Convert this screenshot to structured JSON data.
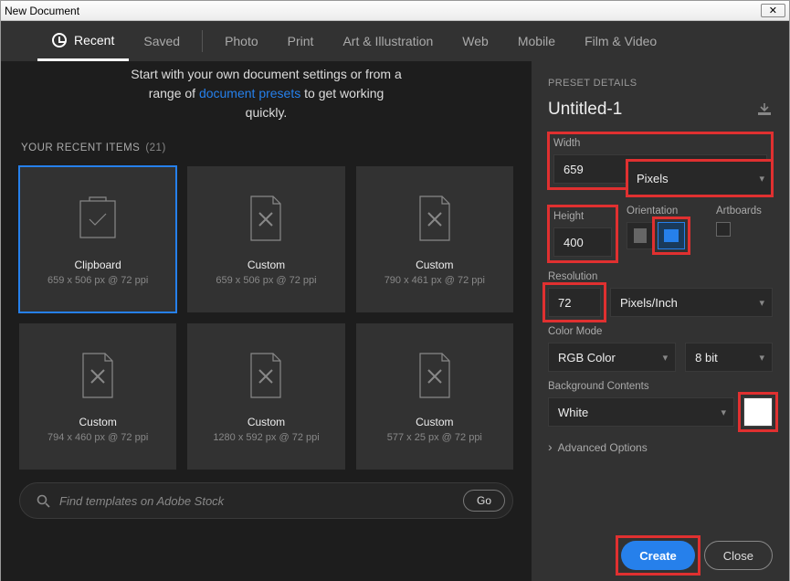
{
  "window": {
    "title": "New Document",
    "close": "✕"
  },
  "tabs": {
    "recent": "Recent",
    "saved": "Saved",
    "photo": "Photo",
    "print": "Print",
    "art": "Art & Illustration",
    "web": "Web",
    "mobile": "Mobile",
    "film": "Film & Video"
  },
  "intro": {
    "line1a": "Start with your own document settings or from a",
    "line2a": "range of ",
    "link": "document presets",
    "line2b": " to get working",
    "line3": "quickly."
  },
  "recent_label": "YOUR RECENT ITEMS",
  "recent_count": "(21)",
  "cards": [
    {
      "title": "Clipboard",
      "sub": "659 x 506 px @ 72 ppi"
    },
    {
      "title": "Custom",
      "sub": "659 x 506 px @ 72 ppi"
    },
    {
      "title": "Custom",
      "sub": "790 x 461 px @ 72 ppi"
    },
    {
      "title": "Custom",
      "sub": "794 x 460 px @ 72 ppi"
    },
    {
      "title": "Custom",
      "sub": "1280 x 592 px @ 72 ppi"
    },
    {
      "title": "Custom",
      "sub": "577 x 25 px @ 72 ppi"
    }
  ],
  "search": {
    "placeholder": "Find templates on Adobe Stock",
    "go": "Go"
  },
  "preset": {
    "header": "PRESET DETAILS",
    "docname": "Untitled-1",
    "width_label": "Width",
    "width_value": "659",
    "units": "Pixels",
    "height_label": "Height",
    "height_value": "400",
    "orientation_label": "Orientation",
    "artboards_label": "Artboards",
    "resolution_label": "Resolution",
    "resolution_value": "72",
    "resolution_units": "Pixels/Inch",
    "colormode_label": "Color Mode",
    "colormode_value": "RGB Color",
    "bitdepth": "8 bit",
    "bg_label": "Background Contents",
    "bg_value": "White",
    "bg_color": "#ffffff",
    "advanced": "Advanced Options"
  },
  "buttons": {
    "create": "Create",
    "close": "Close"
  }
}
